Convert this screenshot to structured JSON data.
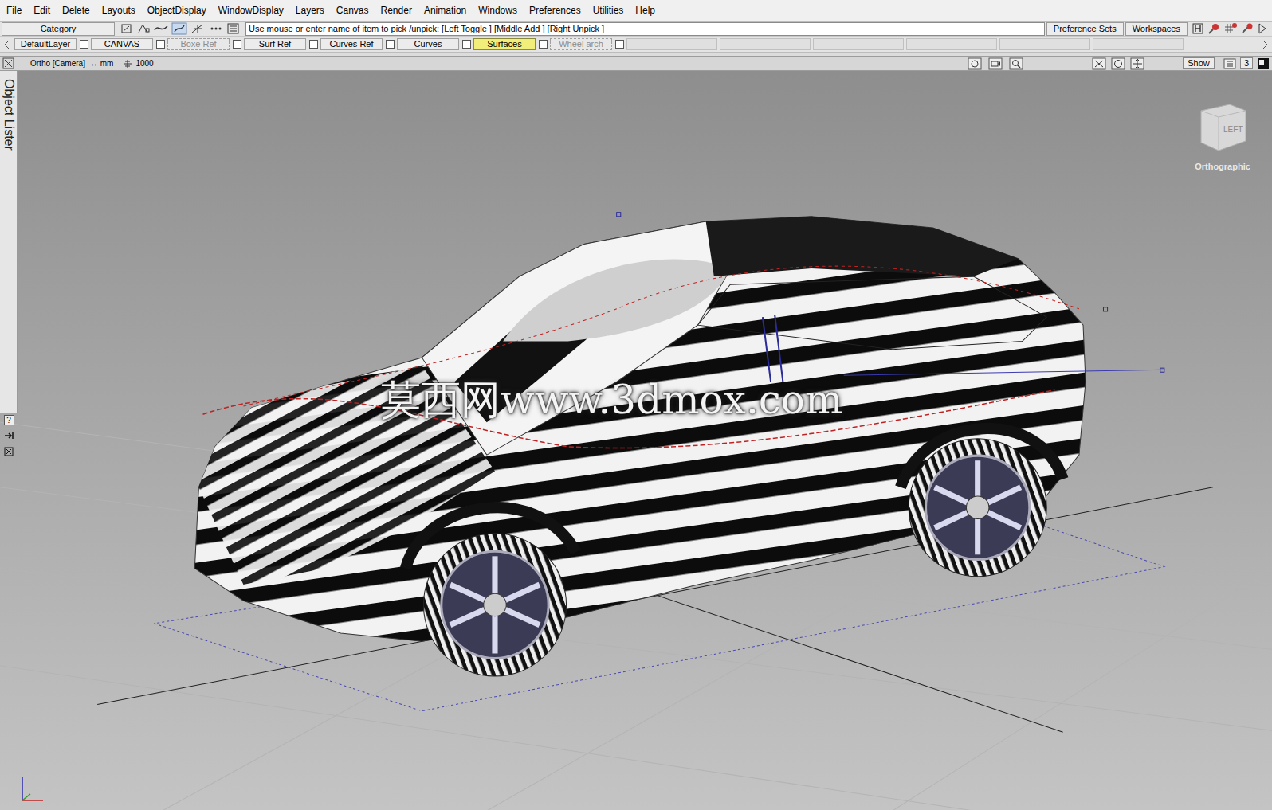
{
  "menu": [
    "File",
    "Edit",
    "Delete",
    "Layouts",
    "ObjectDisplay",
    "WindowDisplay",
    "Layers",
    "Canvas",
    "Render",
    "Animation",
    "Windows",
    "Preferences",
    "Utilities",
    "Help"
  ],
  "toolbar": {
    "category": "Category",
    "prompt": "Use mouse or enter name of item to pick /unpick: [Left Toggle ] [Middle Add ] [Right Unpick ]",
    "buttons": [
      "Preference Sets",
      "Workspaces"
    ]
  },
  "layers": [
    {
      "label": "DefaultLayer",
      "selected": false,
      "disabled": false
    },
    {
      "label": "CANVAS",
      "selected": false,
      "disabled": false
    },
    {
      "label": "Boxe Ref",
      "selected": false,
      "disabled": true
    },
    {
      "label": "Surf Ref",
      "selected": false,
      "disabled": false
    },
    {
      "label": "Curves Ref",
      "selected": false,
      "disabled": false
    },
    {
      "label": "Curves",
      "selected": false,
      "disabled": false
    },
    {
      "label": "Surfaces",
      "selected": true,
      "disabled": false
    },
    {
      "label": "Wheel arch",
      "selected": false,
      "disabled": true
    }
  ],
  "viewport": {
    "title": "Ortho [Camera]",
    "units": "↔ mm",
    "grid": "1000",
    "show": "Show",
    "count": "3",
    "view_cube": {
      "face": "LEFT",
      "label": "Orthographic"
    },
    "watermark": "莫西网www.3dmox.com"
  },
  "object_lister": "Object Lister",
  "side_tools": [
    "?"
  ]
}
